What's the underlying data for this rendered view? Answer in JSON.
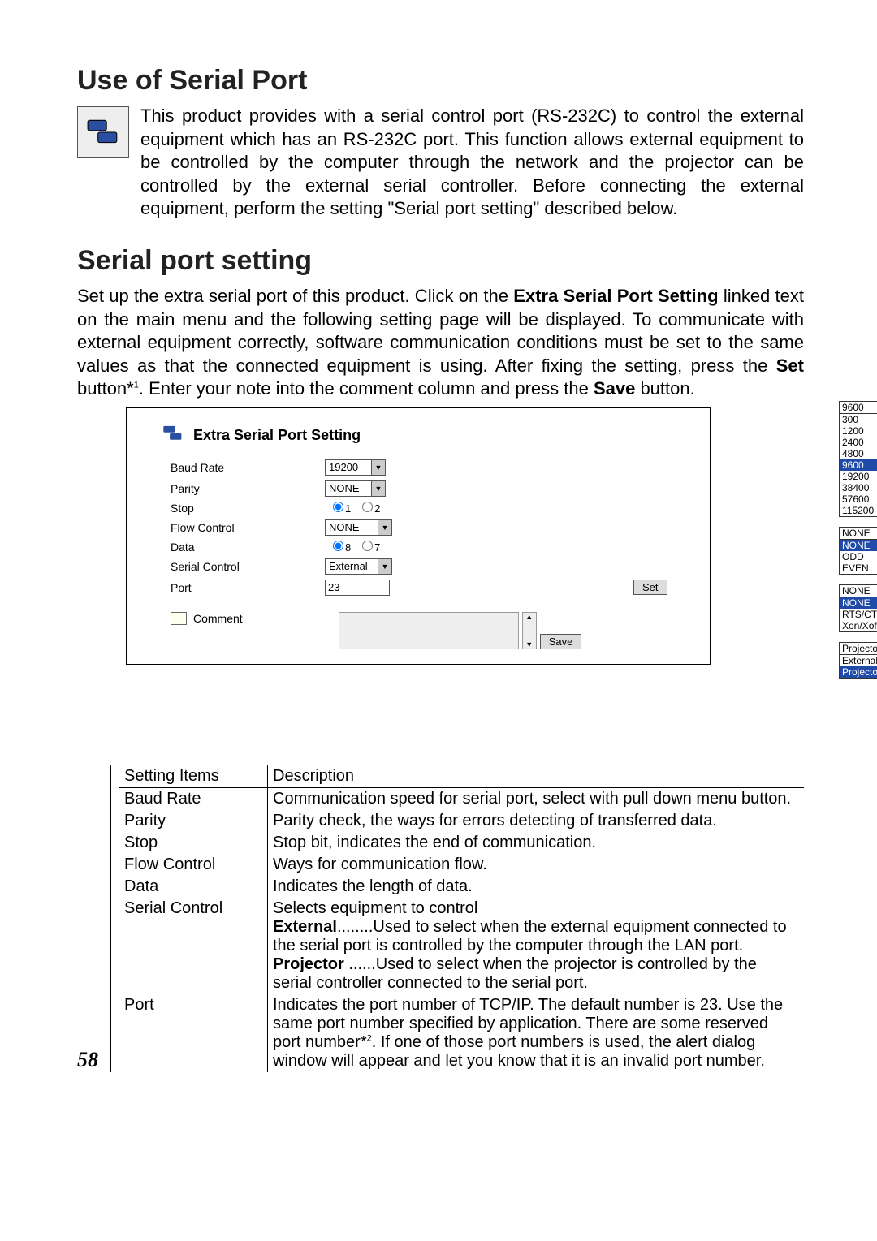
{
  "page_number": "58",
  "heading1": "Use of Serial Port",
  "paragraph1": "This product provides with a serial control port (RS-232C) to control the external equipment which has an RS-232C port. This function allows external equipment to be controlled by the computer through the network and the projector can be controlled by the external serial controller. Before connecting the external equipment, perform the setting \"Serial port setting\" described below.",
  "heading2": "Serial port setting",
  "paragraph2a": "Set up the extra serial port of this product. Click on the ",
  "paragraph2_bold1": "Extra Serial Port Setting",
  "paragraph2b": " linked text on the main menu and the following setting page will be displayed. To communicate with external equipment correctly, software communication conditions must be set to the same values as that the connected equipment is using. After fixing the setting, press the ",
  "paragraph2_bold2": "Set",
  "paragraph2c": " button*",
  "paragraph2_sup": "1",
  "paragraph2d": ". Enter your note into the comment column and press the ",
  "paragraph2_bold3": "Save",
  "paragraph2e": " button.",
  "panel": {
    "title": "Extra Serial Port Setting",
    "rows": {
      "baud_rate": {
        "label": "Baud Rate",
        "value": "19200"
      },
      "parity": {
        "label": "Parity",
        "value": "NONE"
      },
      "stop": {
        "label": "Stop",
        "opt1": "1",
        "opt2": "2"
      },
      "flow": {
        "label": "Flow Control",
        "value": "NONE"
      },
      "data": {
        "label": "Data",
        "opt1": "8",
        "opt2": "7"
      },
      "serial": {
        "label": "Serial Control",
        "value": "External"
      },
      "port": {
        "label": "Port",
        "value": "23"
      }
    },
    "set_btn": "Set",
    "comment_label": "Comment",
    "save_btn": "Save"
  },
  "snips": {
    "baud": {
      "selected": "9600",
      "options": [
        "300",
        "1200",
        "2400",
        "4800",
        "9600",
        "19200",
        "38400",
        "57600",
        "115200"
      ]
    },
    "parity": {
      "selected": "NONE",
      "options": [
        "NONE",
        "ODD",
        "EVEN"
      ]
    },
    "flow": {
      "selected": "NONE",
      "options": [
        "NONE",
        "RTS/CTS",
        "Xon/Xoff"
      ]
    },
    "serial": {
      "selected": "Projector",
      "options": [
        "External",
        "Projector"
      ]
    }
  },
  "table": {
    "headers": {
      "items": "Setting Items",
      "desc": "Description"
    },
    "rows": [
      {
        "item": "Baud Rate",
        "desc": "Communication speed for serial port, select with pull down menu button."
      },
      {
        "item": "Parity",
        "desc": "Parity check, the ways for errors detecting of transferred data."
      },
      {
        "item": "Stop",
        "desc": "Stop bit, indicates the end of communication."
      },
      {
        "item": "Flow Control",
        "desc": "Ways for communication flow."
      },
      {
        "item": "Data",
        "desc": "Indicates the length of data."
      }
    ],
    "serial_row": {
      "item": "Serial Control",
      "main": "Selects equipment to control",
      "ext_k": "External",
      "ext_v": "........Used to select when the external equipment connected to the serial port is controlled by the computer through the LAN port.",
      "proj_k": "Projector",
      "proj_v": " ......Used to select when the projector is controlled by the serial controller connected to the serial port."
    },
    "port_row": {
      "item": "Port",
      "desc_a": "Indicates the port number of TCP/IP. The default number is 23. Use the same port number specified by application. There are some reserved port number*",
      "sup": "2",
      "desc_b": ". If one of those port numbers is used, the alert dialog window will appear and let you know that it is an invalid port number."
    }
  }
}
